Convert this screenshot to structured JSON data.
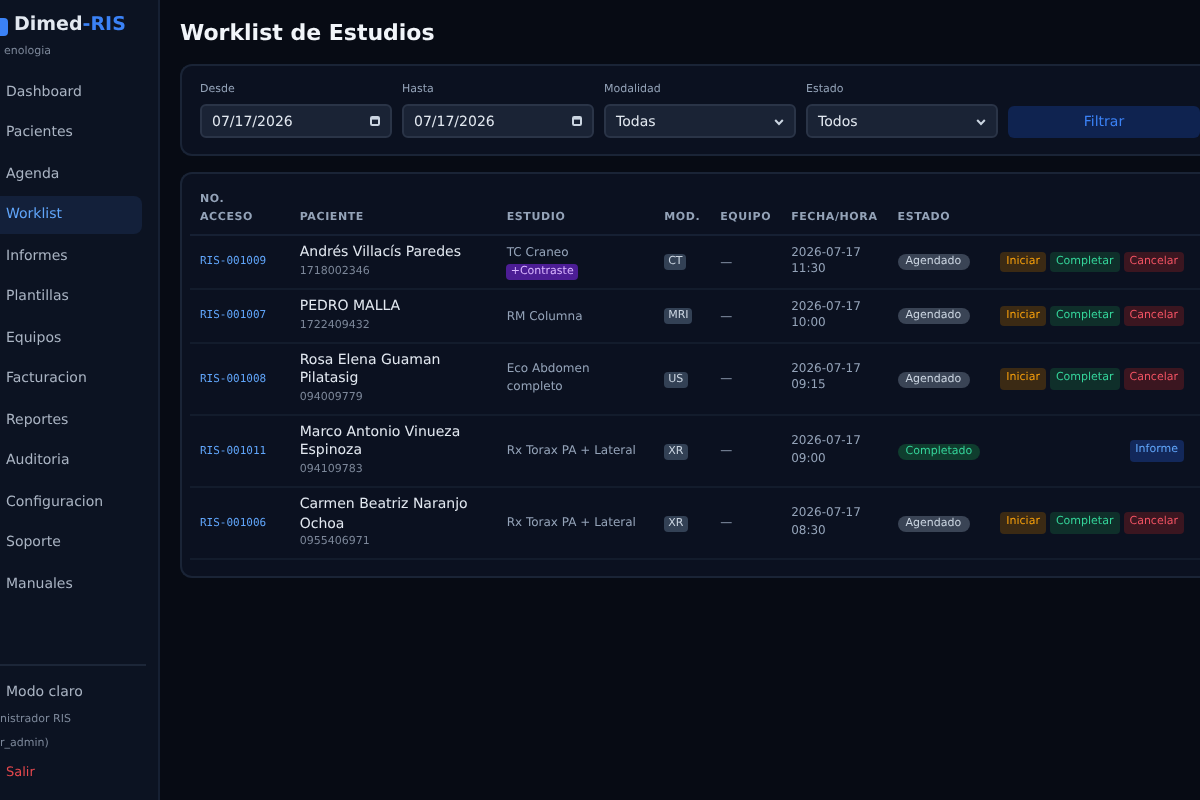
{
  "sidebar": {
    "brand": {
      "name": "Dimed",
      "suffix": "-RIS",
      "subtitle": "enologia"
    },
    "items": [
      {
        "label": "Dashboard",
        "selected": false
      },
      {
        "label": "Pacientes",
        "selected": false
      },
      {
        "label": "Agenda",
        "selected": false
      },
      {
        "label": "Worklist",
        "selected": true
      },
      {
        "label": "Informes",
        "selected": false
      },
      {
        "label": "Plantillas",
        "selected": false
      },
      {
        "label": "Equipos",
        "selected": false
      },
      {
        "label": "Facturacion",
        "selected": false
      },
      {
        "label": "Reportes",
        "selected": false
      },
      {
        "label": "Auditoria",
        "selected": false
      },
      {
        "label": "Configuracion",
        "selected": false
      },
      {
        "label": "Soporte",
        "selected": false
      },
      {
        "label": "Manuales",
        "selected": false
      }
    ],
    "theme_toggle": "Modo claro",
    "user_role": "nistrador RIS",
    "user_login": "r_admin)",
    "logout": "Salir"
  },
  "page_title": "Worklist de Estudios",
  "filters": {
    "fields": [
      {
        "kind": "date",
        "label": "Desde",
        "value": "07/17/2026"
      },
      {
        "kind": "date",
        "label": "Hasta",
        "value": "07/17/2026"
      },
      {
        "kind": "select",
        "label": "Modalidad",
        "value": "Todas"
      },
      {
        "kind": "select",
        "label": "Estado",
        "value": "Todos"
      }
    ],
    "button": "Filtrar"
  },
  "table": {
    "columns": [
      "NO. ACCESO",
      "PACIENTE",
      "ESTUDIO",
      "MOD.",
      "EQUIPO",
      "FECHA/HORA",
      "ESTADO"
    ],
    "rows": [
      {
        "access": "RIS-001009",
        "patient": "Andrés Villacís Paredes",
        "patient_id": "1718002346",
        "study": "TC Craneo",
        "study_tag": "+Contraste",
        "modality": "CT",
        "equipment": "—",
        "date": "2026-07-17",
        "time": "11:30",
        "status": {
          "kind": "scheduled",
          "label": "Agendado"
        },
        "actions": [
          {
            "kind": "start",
            "label": "Iniciar"
          },
          {
            "kind": "complete",
            "label": "Completar"
          },
          {
            "kind": "cancel",
            "label": "Cancelar"
          }
        ]
      },
      {
        "access": "RIS-001007",
        "patient": "PEDRO MALLA",
        "patient_id": "1722409432",
        "study": "RM Columna",
        "modality": "MRI",
        "equipment": "—",
        "date": "2026-07-17",
        "time": "10:00",
        "status": {
          "kind": "scheduled",
          "label": "Agendado"
        },
        "actions": [
          {
            "kind": "start",
            "label": "Iniciar"
          },
          {
            "kind": "complete",
            "label": "Completar"
          },
          {
            "kind": "cancel",
            "label": "Cancelar"
          }
        ]
      },
      {
        "access": "RIS-001008",
        "patient": "Rosa Elena Guaman Pilatasig",
        "patient_id": "094009779",
        "study": "Eco Abdomen completo",
        "modality": "US",
        "equipment": "—",
        "date": "2026-07-17",
        "time": "09:15",
        "status": {
          "kind": "scheduled",
          "label": "Agendado"
        },
        "actions": [
          {
            "kind": "start",
            "label": "Iniciar"
          },
          {
            "kind": "complete",
            "label": "Completar"
          },
          {
            "kind": "cancel",
            "label": "Cancelar"
          }
        ]
      },
      {
        "access": "RIS-001011",
        "patient": "Marco Antonio Vinueza Espinoza",
        "patient_id": "094109783",
        "study": "Rx Torax PA + Lateral",
        "modality": "XR",
        "equipment": "—",
        "date": "2026-07-17",
        "time": "09:00",
        "status": {
          "kind": "completed",
          "label": "Completado"
        },
        "actions": [
          {
            "kind": "report",
            "label": "Informe"
          }
        ]
      },
      {
        "access": "RIS-001006",
        "patient": "Carmen Beatriz Naranjo Ochoa",
        "patient_id": "0955406971",
        "study": "Rx Torax PA + Lateral",
        "modality": "XR",
        "equipment": "—",
        "date": "2026-07-17",
        "time": "08:30",
        "status": {
          "kind": "scheduled",
          "label": "Agendado"
        },
        "actions": [
          {
            "kind": "start",
            "label": "Iniciar"
          },
          {
            "kind": "complete",
            "label": "Completar"
          },
          {
            "kind": "cancel",
            "label": "Cancelar"
          }
        ]
      }
    ]
  }
}
